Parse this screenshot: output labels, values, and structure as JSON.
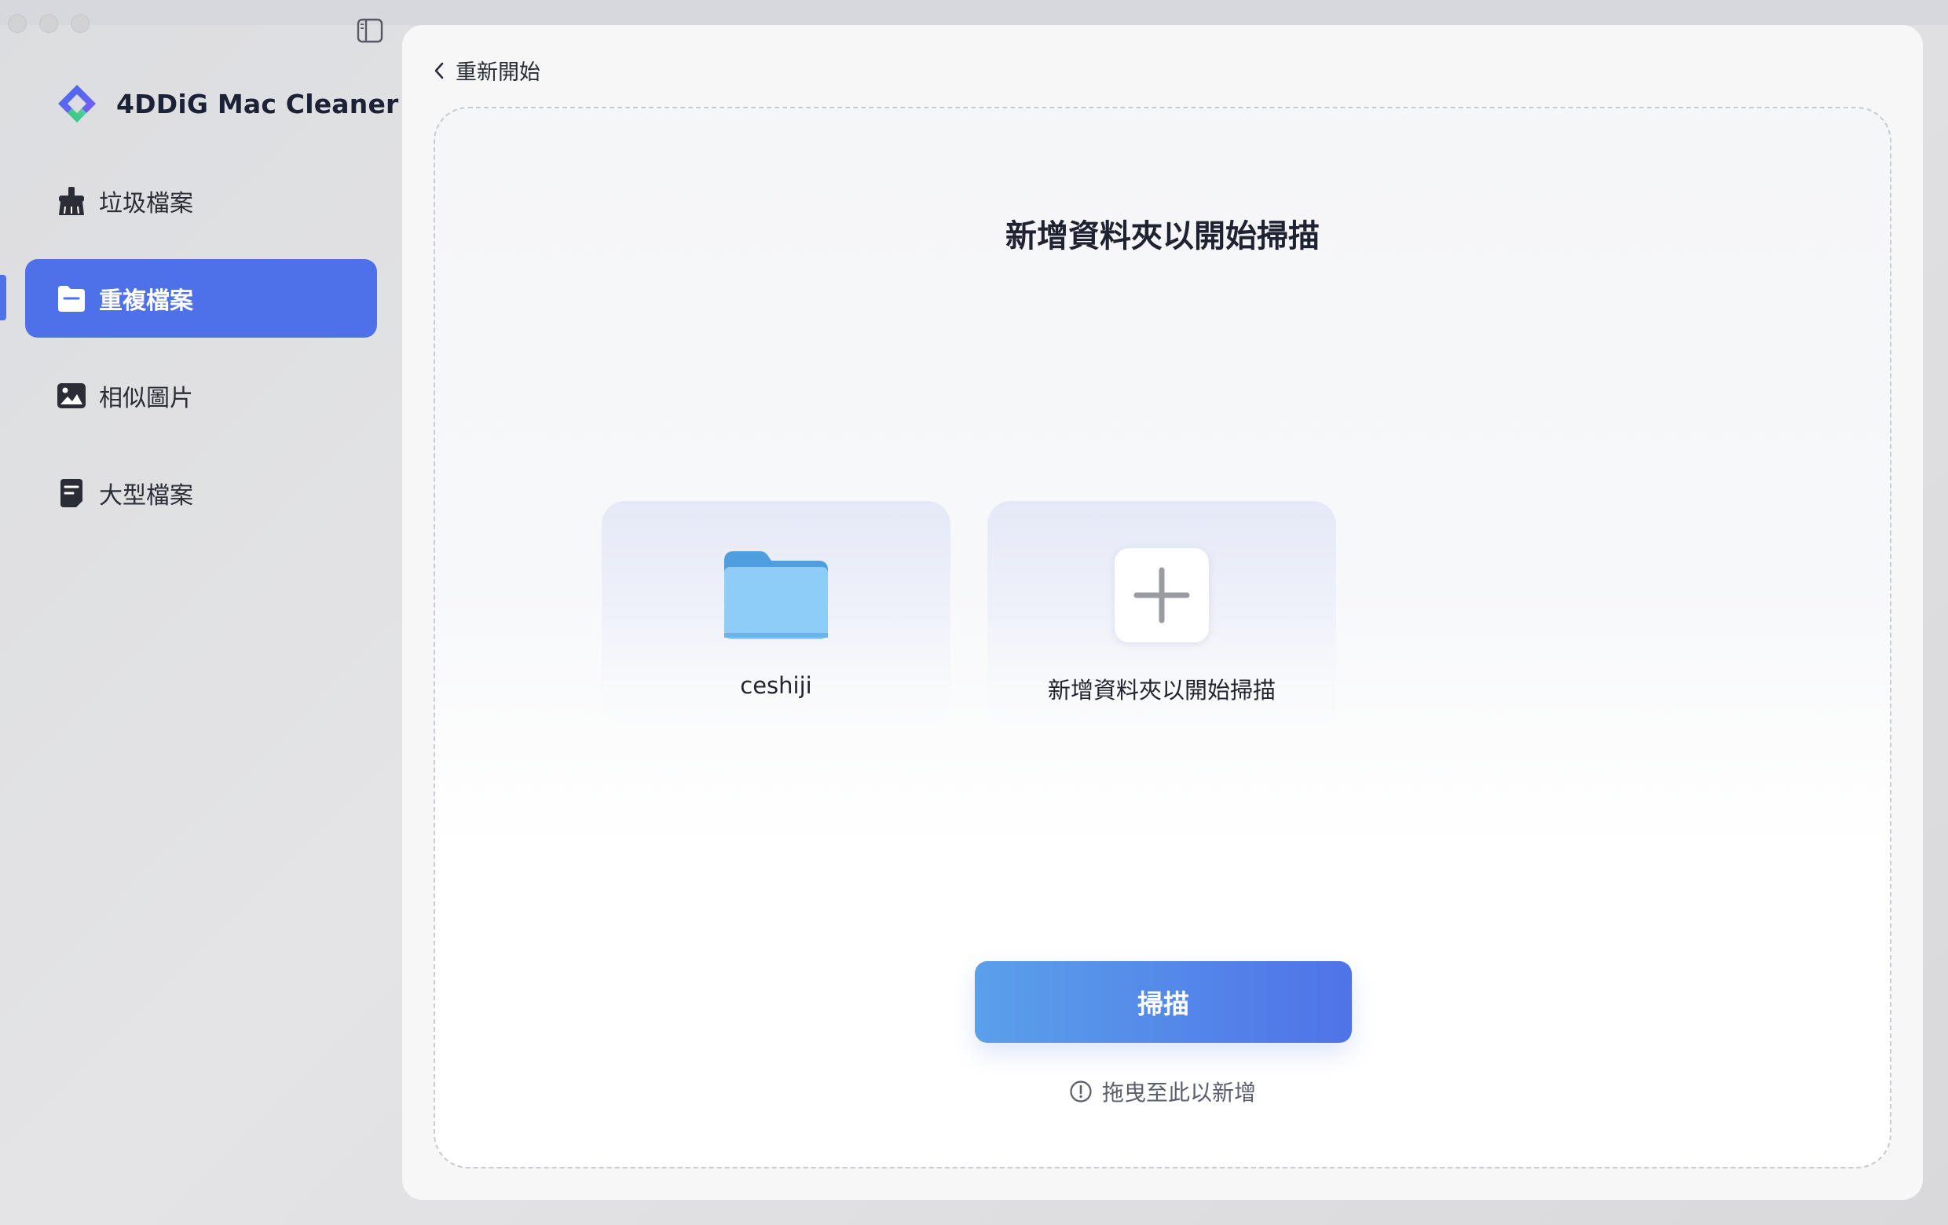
{
  "app": {
    "name": "4DDiG Mac Cleaner"
  },
  "sidebar": {
    "items": [
      {
        "label": "垃圾檔案",
        "icon": "broom-icon",
        "active": false
      },
      {
        "label": "重複檔案",
        "icon": "duplicate-file-icon",
        "active": true
      },
      {
        "label": "相似圖片",
        "icon": "image-icon",
        "active": false
      },
      {
        "label": "大型檔案",
        "icon": "large-file-icon",
        "active": false
      }
    ]
  },
  "header": {
    "back_label": "重新開始"
  },
  "dropzone": {
    "title": "新增資料夾以開始掃描",
    "folders": [
      {
        "name": "ceshiji",
        "icon": "folder-icon"
      }
    ],
    "add_card_label": "新增資料夾以開始掃描",
    "scan_button_label": "掃描",
    "hint": "拖曳至此以新增"
  },
  "colors": {
    "accent": "#4e71ea",
    "scan_gradient_start": "#5aa0ea",
    "scan_gradient_end": "#4f73e8",
    "folder_blue": "#8ecdf7"
  }
}
